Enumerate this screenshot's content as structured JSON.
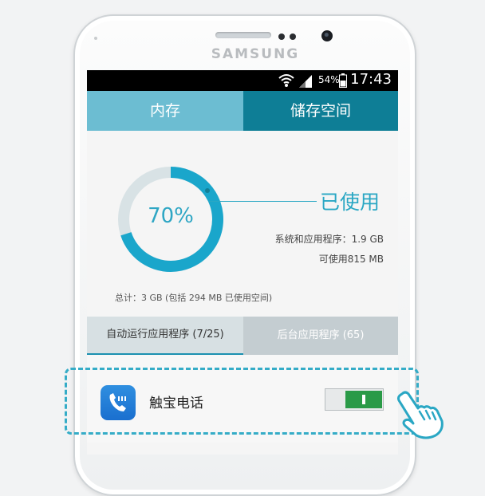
{
  "device": {
    "brand": "SAMSUNG"
  },
  "status_bar": {
    "battery": "54%",
    "time": "17:43"
  },
  "tabs": [
    {
      "label": "内存",
      "active": false
    },
    {
      "label": "储存空间",
      "active": true
    }
  ],
  "memory": {
    "used_percent_label": "70%",
    "used_fraction": 0.7,
    "used_label": "已使用",
    "system_info": "系统和应用程序：1.9 GB",
    "free_info": "可使用815 MB",
    "total_info": "总计：3 GB (包括 294 MB 已使用空间)"
  },
  "sub_tabs": [
    {
      "label": "自动运行应用程序 (7/25)",
      "active": true
    },
    {
      "label": "后台应用程序 (65)",
      "active": false
    }
  ],
  "apps": [
    {
      "name": "触宝电话",
      "enabled": true
    }
  ],
  "colors": {
    "accent": "#2aa7c4",
    "tab_light": "#6cbdd2",
    "tab_dark": "#0e7e96",
    "toggle_on": "#2a9a47"
  },
  "icons": [
    "wifi-icon",
    "signal-icon",
    "battery-icon",
    "phone-app-icon",
    "pointing-hand-icon"
  ]
}
